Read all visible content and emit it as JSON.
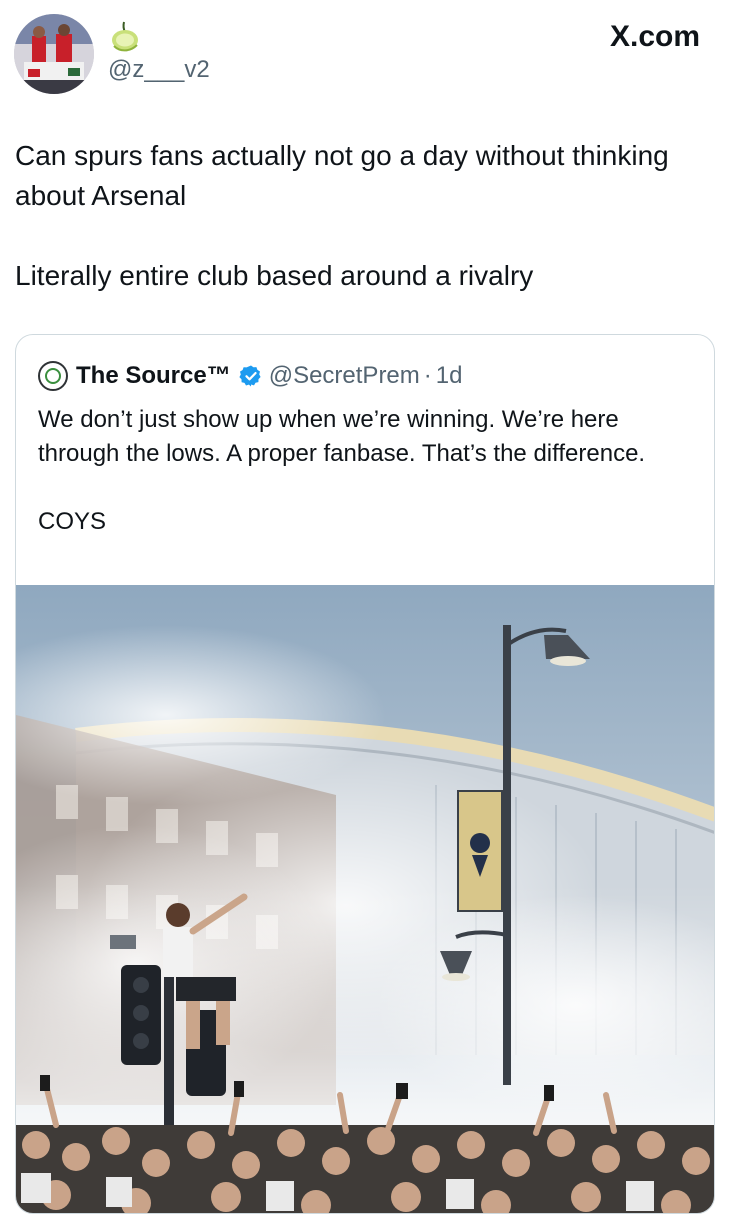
{
  "tweet": {
    "handle": "@z___v2",
    "emoji_icon": "lime-icon",
    "text_paragraphs": [
      "Can spurs fans actually not go a day without thinking about Arsenal",
      "Literally entire club based around a rivalry"
    ]
  },
  "site_label": "X.com",
  "quote": {
    "name": "The Source™",
    "handle": "@SecretPrem",
    "separator": "·",
    "time": "1d",
    "verified_color": "#1d9bf0",
    "text_paragraphs": [
      "We don’t just show up when we’re winning. We’re here through the lows. A proper fanbase. That’s the difference.",
      "COYS"
    ]
  },
  "colors": {
    "text_primary": "#0f1419",
    "text_secondary": "#536471",
    "border": "#cfd9de",
    "verified": "#1d9bf0"
  }
}
